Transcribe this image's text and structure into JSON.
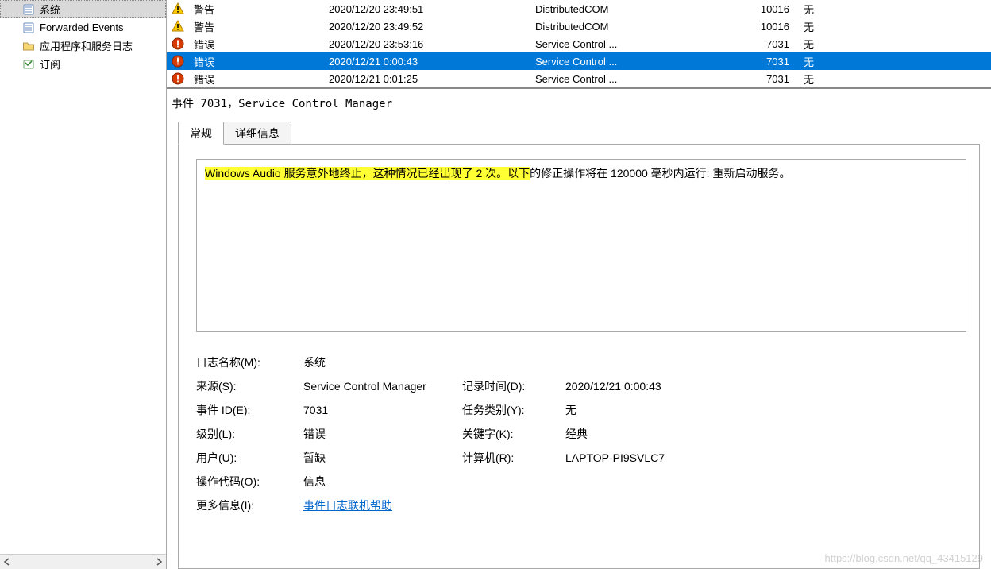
{
  "tree": {
    "items": [
      {
        "label": "系统",
        "icon": "log-icon",
        "selected": true
      },
      {
        "label": "Forwarded Events",
        "icon": "log-icon",
        "selected": false
      },
      {
        "label": "应用程序和服务日志",
        "icon": "folder-icon",
        "selected": false
      },
      {
        "label": "订阅",
        "icon": "sub-icon",
        "selected": false
      }
    ]
  },
  "events": {
    "rows": [
      {
        "level": "警告",
        "icon": "warning-icon",
        "date": "2020/12/20 23:49:51",
        "source": "DistributedCOM",
        "eid": "10016",
        "task": "无",
        "selected": false
      },
      {
        "level": "警告",
        "icon": "warning-icon",
        "date": "2020/12/20 23:49:52",
        "source": "DistributedCOM",
        "eid": "10016",
        "task": "无",
        "selected": false
      },
      {
        "level": "错误",
        "icon": "error-icon",
        "date": "2020/12/20 23:53:16",
        "source": "Service Control ...",
        "eid": "7031",
        "task": "无",
        "selected": false
      },
      {
        "level": "错误",
        "icon": "error-icon",
        "date": "2020/12/21 0:00:43",
        "source": "Service Control ...",
        "eid": "7031",
        "task": "无",
        "selected": true
      },
      {
        "level": "错误",
        "icon": "error-icon",
        "date": "2020/12/21 0:01:25",
        "source": "Service Control ...",
        "eid": "7031",
        "task": "无",
        "selected": false
      }
    ]
  },
  "detail": {
    "title": "事件 7031，Service Control Manager",
    "tabs": {
      "general": "常规",
      "details": "详细信息"
    },
    "description_hl": "Windows Audio 服务意外地终止，这种情况已经出现了 2 次。以下",
    "description_rest": "的修正操作将在 120000 毫秒内运行: 重新启动服务。",
    "labels": {
      "log_name": "日志名称(M):",
      "source": "来源(S):",
      "event_id": "事件 ID(E):",
      "level": "级别(L):",
      "user": "用户(U):",
      "opcode": "操作代码(O):",
      "more": "更多信息(I):",
      "logged": "记录时间(D):",
      "task_cat": "任务类别(Y):",
      "keywords": "关键字(K):",
      "computer": "计算机(R):"
    },
    "values": {
      "log_name": "系统",
      "source": "Service Control Manager",
      "event_id": "7031",
      "level": "错误",
      "user": "暂缺",
      "opcode": "信息",
      "more": "事件日志联机帮助",
      "logged": "2020/12/21 0:00:43",
      "task_cat": "无",
      "keywords": "经典",
      "computer": "LAPTOP-PI9SVLC7"
    }
  },
  "watermark": "https://blog.csdn.net/qq_43415129"
}
